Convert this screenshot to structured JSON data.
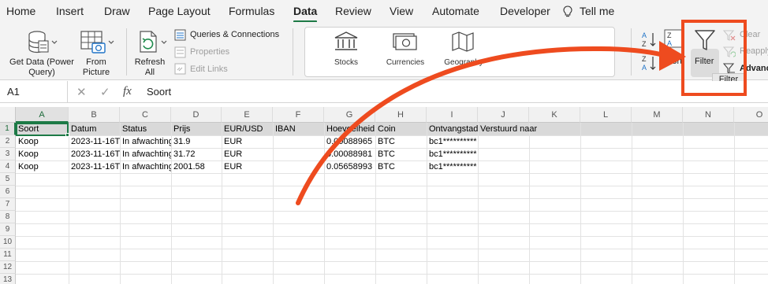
{
  "menu": {
    "tabs": [
      "Home",
      "Insert",
      "Draw",
      "Page Layout",
      "Formulas",
      "Data",
      "Review",
      "View",
      "Automate",
      "Developer",
      "Tell me"
    ],
    "active_tab": "Data"
  },
  "ribbon": {
    "get_data": "Get Data (Power Query)",
    "from_picture": "From Picture",
    "refresh_all": "Refresh All",
    "queries_connections": "Queries & Connections",
    "properties": "Properties",
    "edit_links": "Edit Links",
    "data_types": [
      "Stocks",
      "Currencies",
      "Geography"
    ],
    "sort": "Sort",
    "filter": "Filter",
    "clear": "Clear",
    "reapply": "Reapply",
    "advanced": "Advanced",
    "tooltip": "Filter"
  },
  "formula_bar": {
    "name_box": "A1",
    "fx": "fx",
    "content": "Soort"
  },
  "sheet": {
    "columns": [
      "A",
      "B",
      "C",
      "D",
      "E",
      "F",
      "G",
      "H",
      "I",
      "J",
      "K",
      "L",
      "M",
      "N",
      "O"
    ],
    "selected_column": "A",
    "rows": [
      "1",
      "2",
      "3",
      "4",
      "5",
      "6",
      "7",
      "8",
      "9",
      "10",
      "11",
      "12",
      "13"
    ],
    "header_row": [
      "Soort",
      "Datum",
      "Status",
      "Prijs",
      "EUR/USD",
      "IBAN",
      "Hoeveelheid",
      "Coin",
      "Ontvangstadres",
      "Verstuurd naar"
    ],
    "data_rows": [
      [
        "Koop",
        "2023-11-16T",
        "In afwachting",
        "31.9",
        "EUR",
        "",
        "0.00088965",
        "BTC",
        "bc1**********"
      ],
      [
        "Koop",
        "2023-11-16T",
        "In afwachting",
        "31.72",
        "EUR",
        "",
        "0.00088981",
        "BTC",
        "bc1**********"
      ],
      [
        "Koop",
        "2023-11-16T",
        "In afwachting",
        "2001.58",
        "EUR",
        "",
        "0.05658993",
        "BTC",
        "bc1**********"
      ]
    ]
  },
  "annotation": {
    "arrow_color": "#ee4b1f",
    "highlight_color": "#ee4b1f"
  }
}
